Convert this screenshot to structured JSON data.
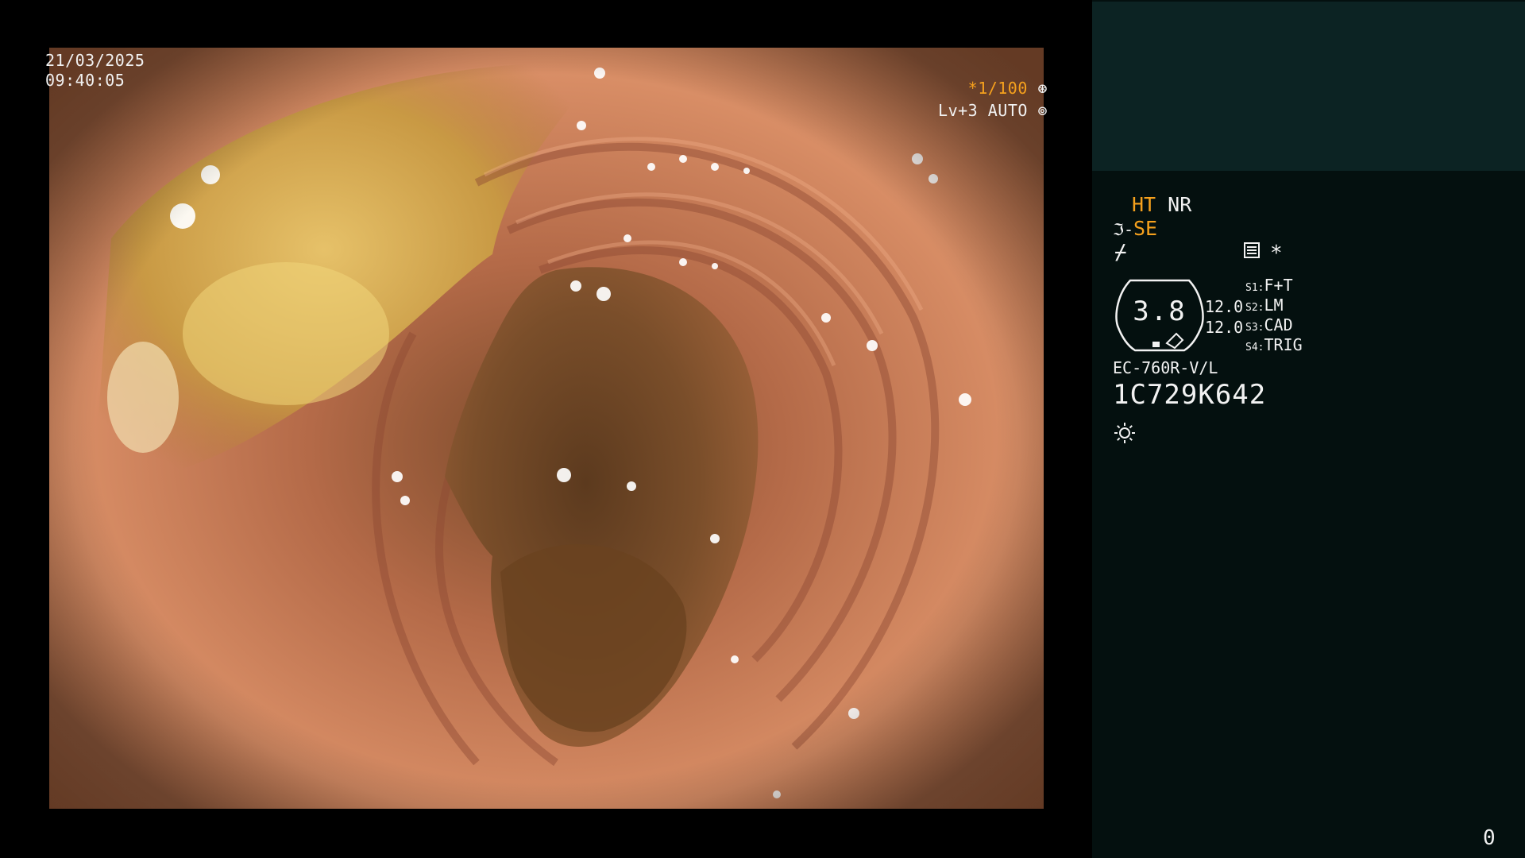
{
  "osd": {
    "date": "21/03/2025",
    "time": "09:40:05",
    "shutter_prefix": "*",
    "shutter": "1/100",
    "exposure": "Lv+3 AUTO",
    "icons": [
      "shutter-icon",
      "iris-icon"
    ]
  },
  "panel": {
    "ht_label": "HT",
    "nr_label": "NR",
    "se_label": "SE",
    "asterisk": "*",
    "gauge_value": "3.8",
    "value1": "12.0",
    "value2": "12.0",
    "switches": [
      {
        "key": "S1:",
        "value": "F+T"
      },
      {
        "key": "S2:",
        "value": "LM"
      },
      {
        "key": "S3:",
        "value": "CAD"
      },
      {
        "key": "S4:",
        "value": "TRIG"
      }
    ],
    "scope_model": "EC-760R-V/L",
    "serial": "1C729K642",
    "frame_count": "0",
    "icons": [
      "scope-tip-icon",
      "enhance-icon",
      "list-icon",
      "light-icon"
    ]
  },
  "colors": {
    "background": "#000000",
    "panel_bg": "#04100f",
    "panel_top_bg": "#0c2323",
    "accent_orange": "#f6a11d",
    "text": "#f2f2f2"
  }
}
